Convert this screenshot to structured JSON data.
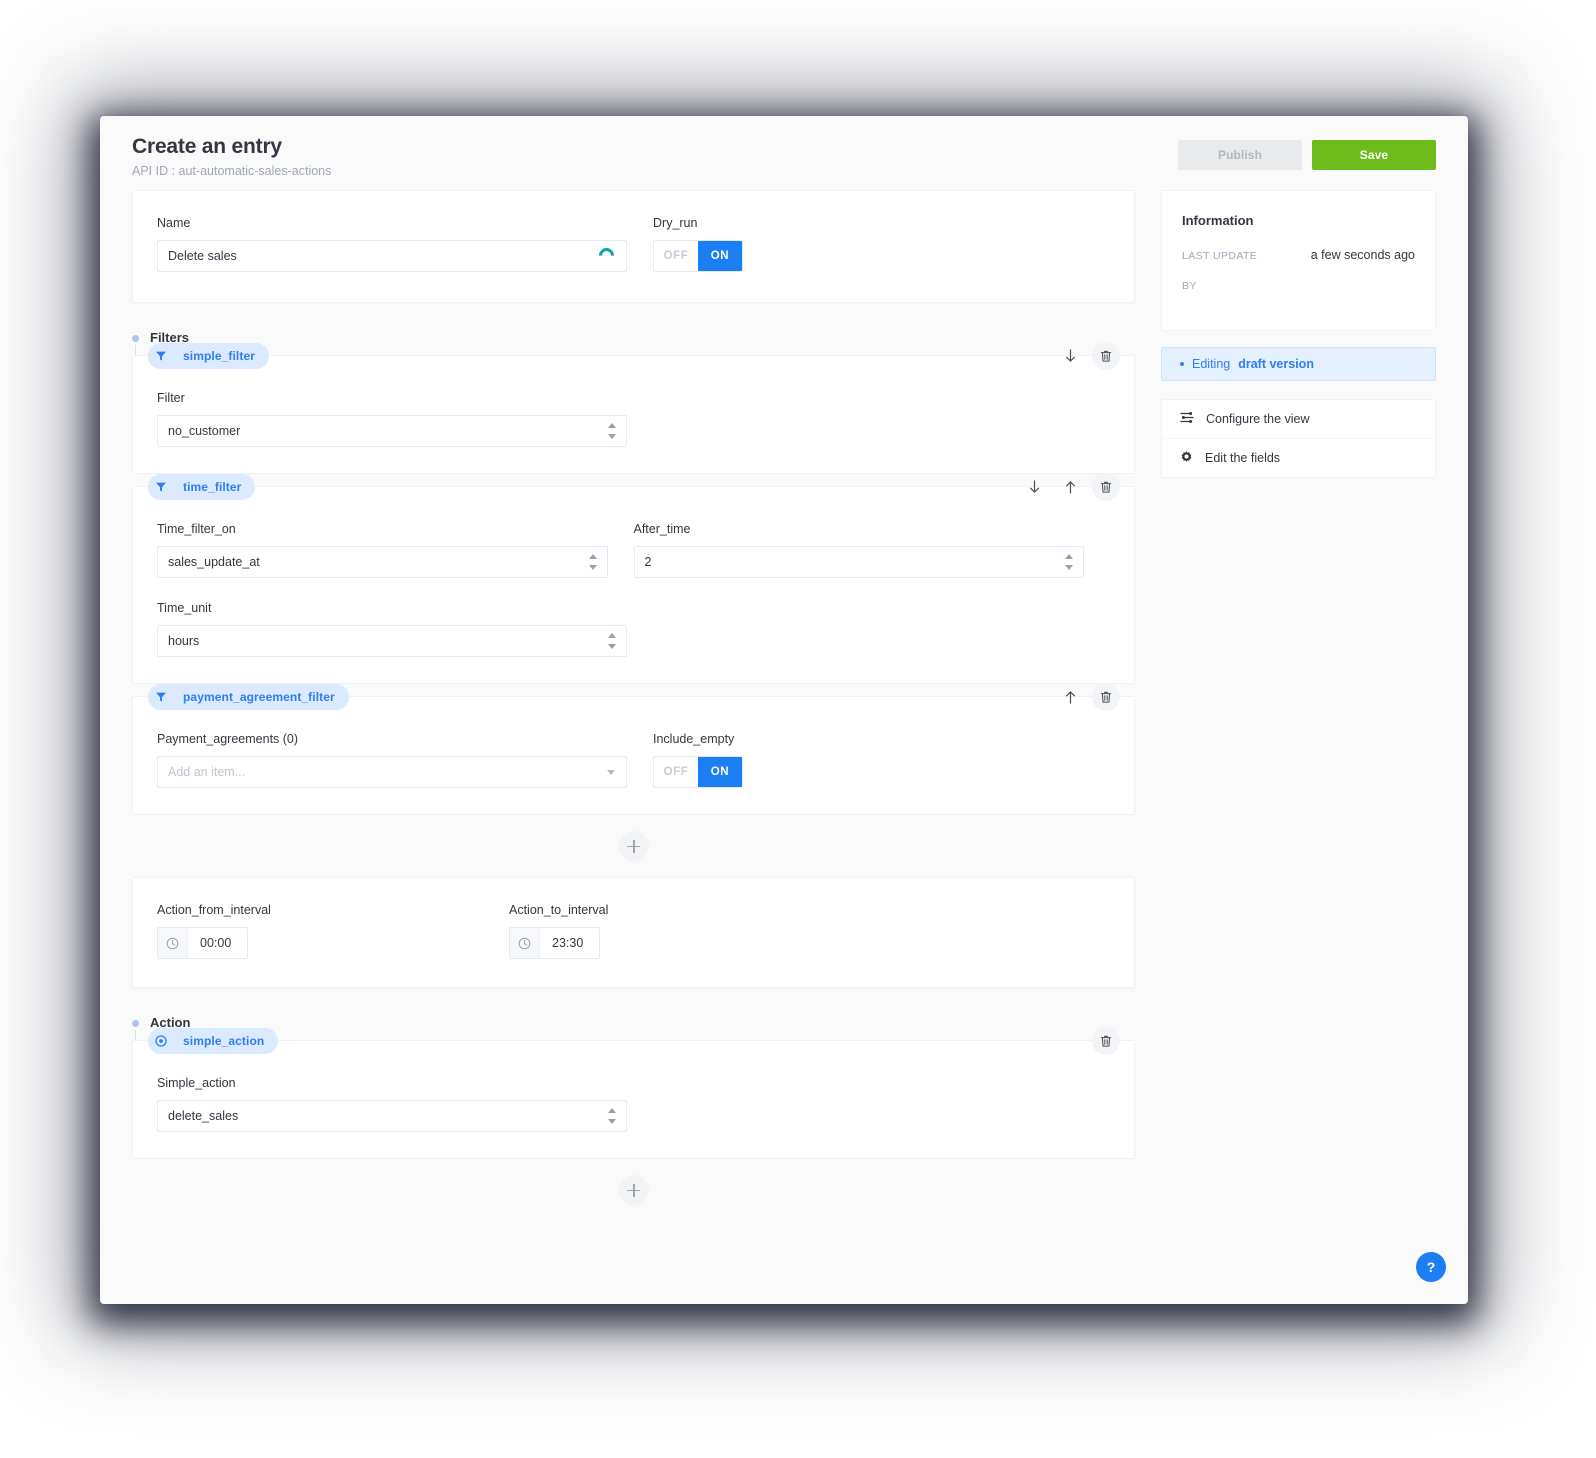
{
  "header": {
    "title": "Create an entry",
    "api_id": "API ID : aut-automatic-sales-actions",
    "publish_label": "Publish",
    "save_label": "Save",
    "save_color": "#6dbb1a",
    "publish_color": "#e9eaeb"
  },
  "top_fields": {
    "name_label": "Name",
    "name_value": "Delete sales",
    "name_spinner_color": "#10a5a5",
    "dry_run_label": "Dry_run",
    "toggle_off": "OFF",
    "toggle_on": "ON",
    "dry_run_state": "ON",
    "toggle_on_color": "#1c7ef3"
  },
  "filters_group": {
    "title": "Filters",
    "components": [
      {
        "pill_label": "simple_filter",
        "icon": "filter-icon",
        "tools": [
          "move-down-icon",
          "delete-icon"
        ],
        "fields": [
          {
            "label": "Filter",
            "value": "no_customer",
            "control": "select"
          }
        ]
      },
      {
        "pill_label": "time_filter",
        "icon": "filter-icon",
        "tools": [
          "move-down-icon",
          "move-up-icon",
          "delete-icon"
        ],
        "fields": [
          {
            "label": "Time_filter_on",
            "value": "sales_update_at",
            "control": "select"
          },
          {
            "label": "After_time",
            "value": "2",
            "control": "select"
          },
          {
            "label": "Time_unit",
            "value": "hours",
            "control": "select"
          }
        ]
      },
      {
        "pill_label": "payment_agreement_filter",
        "icon": "filter-icon",
        "tools": [
          "move-up-icon",
          "delete-icon"
        ],
        "fields": [
          {
            "label": "Payment_agreements (0)",
            "value": "",
            "placeholder": "Add an item...",
            "control": "combobox"
          },
          {
            "label": "Include_empty",
            "value": "ON",
            "control": "toggle"
          }
        ]
      }
    ]
  },
  "interval_card": {
    "from_label": "Action_from_interval",
    "from_value": "00:00",
    "to_label": "Action_to_interval",
    "to_value": "23:30",
    "clock_icon": "clock-icon"
  },
  "action_group": {
    "title": "Action",
    "components": [
      {
        "pill_label": "simple_action",
        "icon": "action-target-icon",
        "tools": [
          "delete-icon"
        ],
        "fields": [
          {
            "label": "Simple_action",
            "value": "delete_sales",
            "control": "select"
          }
        ]
      }
    ]
  },
  "add_buttons": {
    "filters_add": "+",
    "action_add": "+"
  },
  "sidebar": {
    "information_title": "Information",
    "last_update_key": "LAST UPDATE",
    "last_update_value": "a few seconds ago",
    "by_key": "BY",
    "by_value": "",
    "draft_prefix": "Editing",
    "draft_strong": "draft version",
    "draft_color": "#2f7df4",
    "items": [
      {
        "label": "Configure the view",
        "icon": "sliders-icon"
      },
      {
        "label": "Edit the fields",
        "icon": "gear-icon"
      }
    ]
  },
  "help": {
    "label": "?",
    "color": "#1c7ef3"
  }
}
